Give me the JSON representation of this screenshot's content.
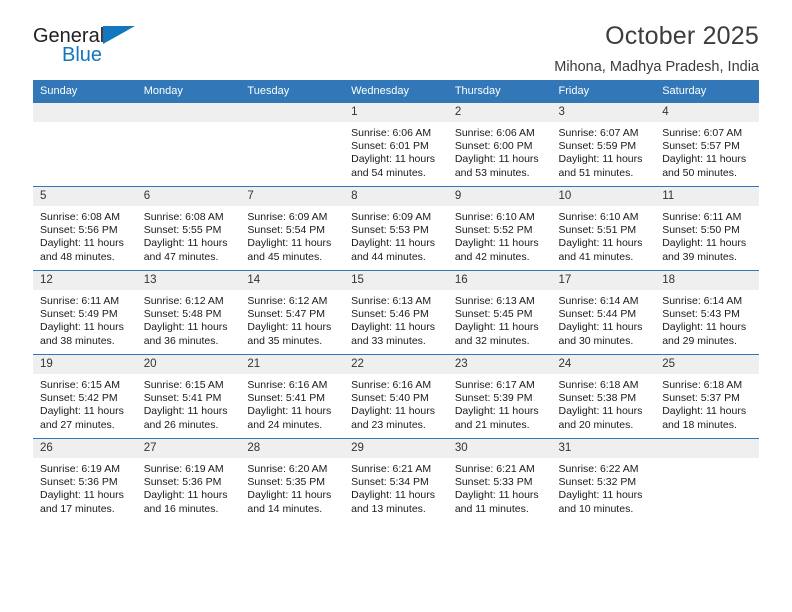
{
  "brand": {
    "name_top": "General",
    "name_bottom": "Blue",
    "logo_icon": "triangle-flag-icon"
  },
  "header": {
    "title": "October 2025",
    "subtitle": "Mihona, Madhya Pradesh, India"
  },
  "colors": {
    "header_blue": "#3277b8",
    "brand_blue": "#1277bc",
    "daynum_bg": "#efefef",
    "grid_line": "#bfbfbf",
    "text": "#1a1a1a"
  },
  "weekdays": [
    "Sunday",
    "Monday",
    "Tuesday",
    "Wednesday",
    "Thursday",
    "Friday",
    "Saturday"
  ],
  "labels": {
    "sunrise_prefix": "Sunrise:",
    "sunset_prefix": "Sunset:",
    "daylight_prefix": "Daylight:"
  },
  "weeks": [
    [
      {
        "day": "",
        "empty": true
      },
      {
        "day": "",
        "empty": true
      },
      {
        "day": "",
        "empty": true
      },
      {
        "day": "1",
        "sunrise": "Sunrise: 6:06 AM",
        "sunset": "Sunset: 6:01 PM",
        "daylight1": "Daylight: 11 hours",
        "daylight2": "and 54 minutes."
      },
      {
        "day": "2",
        "sunrise": "Sunrise: 6:06 AM",
        "sunset": "Sunset: 6:00 PM",
        "daylight1": "Daylight: 11 hours",
        "daylight2": "and 53 minutes."
      },
      {
        "day": "3",
        "sunrise": "Sunrise: 6:07 AM",
        "sunset": "Sunset: 5:59 PM",
        "daylight1": "Daylight: 11 hours",
        "daylight2": "and 51 minutes."
      },
      {
        "day": "4",
        "sunrise": "Sunrise: 6:07 AM",
        "sunset": "Sunset: 5:57 PM",
        "daylight1": "Daylight: 11 hours",
        "daylight2": "and 50 minutes."
      }
    ],
    [
      {
        "day": "5",
        "sunrise": "Sunrise: 6:08 AM",
        "sunset": "Sunset: 5:56 PM",
        "daylight1": "Daylight: 11 hours",
        "daylight2": "and 48 minutes."
      },
      {
        "day": "6",
        "sunrise": "Sunrise: 6:08 AM",
        "sunset": "Sunset: 5:55 PM",
        "daylight1": "Daylight: 11 hours",
        "daylight2": "and 47 minutes."
      },
      {
        "day": "7",
        "sunrise": "Sunrise: 6:09 AM",
        "sunset": "Sunset: 5:54 PM",
        "daylight1": "Daylight: 11 hours",
        "daylight2": "and 45 minutes."
      },
      {
        "day": "8",
        "sunrise": "Sunrise: 6:09 AM",
        "sunset": "Sunset: 5:53 PM",
        "daylight1": "Daylight: 11 hours",
        "daylight2": "and 44 minutes."
      },
      {
        "day": "9",
        "sunrise": "Sunrise: 6:10 AM",
        "sunset": "Sunset: 5:52 PM",
        "daylight1": "Daylight: 11 hours",
        "daylight2": "and 42 minutes."
      },
      {
        "day": "10",
        "sunrise": "Sunrise: 6:10 AM",
        "sunset": "Sunset: 5:51 PM",
        "daylight1": "Daylight: 11 hours",
        "daylight2": "and 41 minutes."
      },
      {
        "day": "11",
        "sunrise": "Sunrise: 6:11 AM",
        "sunset": "Sunset: 5:50 PM",
        "daylight1": "Daylight: 11 hours",
        "daylight2": "and 39 minutes."
      }
    ],
    [
      {
        "day": "12",
        "sunrise": "Sunrise: 6:11 AM",
        "sunset": "Sunset: 5:49 PM",
        "daylight1": "Daylight: 11 hours",
        "daylight2": "and 38 minutes."
      },
      {
        "day": "13",
        "sunrise": "Sunrise: 6:12 AM",
        "sunset": "Sunset: 5:48 PM",
        "daylight1": "Daylight: 11 hours",
        "daylight2": "and 36 minutes."
      },
      {
        "day": "14",
        "sunrise": "Sunrise: 6:12 AM",
        "sunset": "Sunset: 5:47 PM",
        "daylight1": "Daylight: 11 hours",
        "daylight2": "and 35 minutes."
      },
      {
        "day": "15",
        "sunrise": "Sunrise: 6:13 AM",
        "sunset": "Sunset: 5:46 PM",
        "daylight1": "Daylight: 11 hours",
        "daylight2": "and 33 minutes."
      },
      {
        "day": "16",
        "sunrise": "Sunrise: 6:13 AM",
        "sunset": "Sunset: 5:45 PM",
        "daylight1": "Daylight: 11 hours",
        "daylight2": "and 32 minutes."
      },
      {
        "day": "17",
        "sunrise": "Sunrise: 6:14 AM",
        "sunset": "Sunset: 5:44 PM",
        "daylight1": "Daylight: 11 hours",
        "daylight2": "and 30 minutes."
      },
      {
        "day": "18",
        "sunrise": "Sunrise: 6:14 AM",
        "sunset": "Sunset: 5:43 PM",
        "daylight1": "Daylight: 11 hours",
        "daylight2": "and 29 minutes."
      }
    ],
    [
      {
        "day": "19",
        "sunrise": "Sunrise: 6:15 AM",
        "sunset": "Sunset: 5:42 PM",
        "daylight1": "Daylight: 11 hours",
        "daylight2": "and 27 minutes."
      },
      {
        "day": "20",
        "sunrise": "Sunrise: 6:15 AM",
        "sunset": "Sunset: 5:41 PM",
        "daylight1": "Daylight: 11 hours",
        "daylight2": "and 26 minutes."
      },
      {
        "day": "21",
        "sunrise": "Sunrise: 6:16 AM",
        "sunset": "Sunset: 5:41 PM",
        "daylight1": "Daylight: 11 hours",
        "daylight2": "and 24 minutes."
      },
      {
        "day": "22",
        "sunrise": "Sunrise: 6:16 AM",
        "sunset": "Sunset: 5:40 PM",
        "daylight1": "Daylight: 11 hours",
        "daylight2": "and 23 minutes."
      },
      {
        "day": "23",
        "sunrise": "Sunrise: 6:17 AM",
        "sunset": "Sunset: 5:39 PM",
        "daylight1": "Daylight: 11 hours",
        "daylight2": "and 21 minutes."
      },
      {
        "day": "24",
        "sunrise": "Sunrise: 6:18 AM",
        "sunset": "Sunset: 5:38 PM",
        "daylight1": "Daylight: 11 hours",
        "daylight2": "and 20 minutes."
      },
      {
        "day": "25",
        "sunrise": "Sunrise: 6:18 AM",
        "sunset": "Sunset: 5:37 PM",
        "daylight1": "Daylight: 11 hours",
        "daylight2": "and 18 minutes."
      }
    ],
    [
      {
        "day": "26",
        "sunrise": "Sunrise: 6:19 AM",
        "sunset": "Sunset: 5:36 PM",
        "daylight1": "Daylight: 11 hours",
        "daylight2": "and 17 minutes."
      },
      {
        "day": "27",
        "sunrise": "Sunrise: 6:19 AM",
        "sunset": "Sunset: 5:36 PM",
        "daylight1": "Daylight: 11 hours",
        "daylight2": "and 16 minutes."
      },
      {
        "day": "28",
        "sunrise": "Sunrise: 6:20 AM",
        "sunset": "Sunset: 5:35 PM",
        "daylight1": "Daylight: 11 hours",
        "daylight2": "and 14 minutes."
      },
      {
        "day": "29",
        "sunrise": "Sunrise: 6:21 AM",
        "sunset": "Sunset: 5:34 PM",
        "daylight1": "Daylight: 11 hours",
        "daylight2": "and 13 minutes."
      },
      {
        "day": "30",
        "sunrise": "Sunrise: 6:21 AM",
        "sunset": "Sunset: 5:33 PM",
        "daylight1": "Daylight: 11 hours",
        "daylight2": "and 11 minutes."
      },
      {
        "day": "31",
        "sunrise": "Sunrise: 6:22 AM",
        "sunset": "Sunset: 5:32 PM",
        "daylight1": "Daylight: 11 hours",
        "daylight2": "and 10 minutes."
      },
      {
        "day": "",
        "empty": true
      }
    ]
  ]
}
